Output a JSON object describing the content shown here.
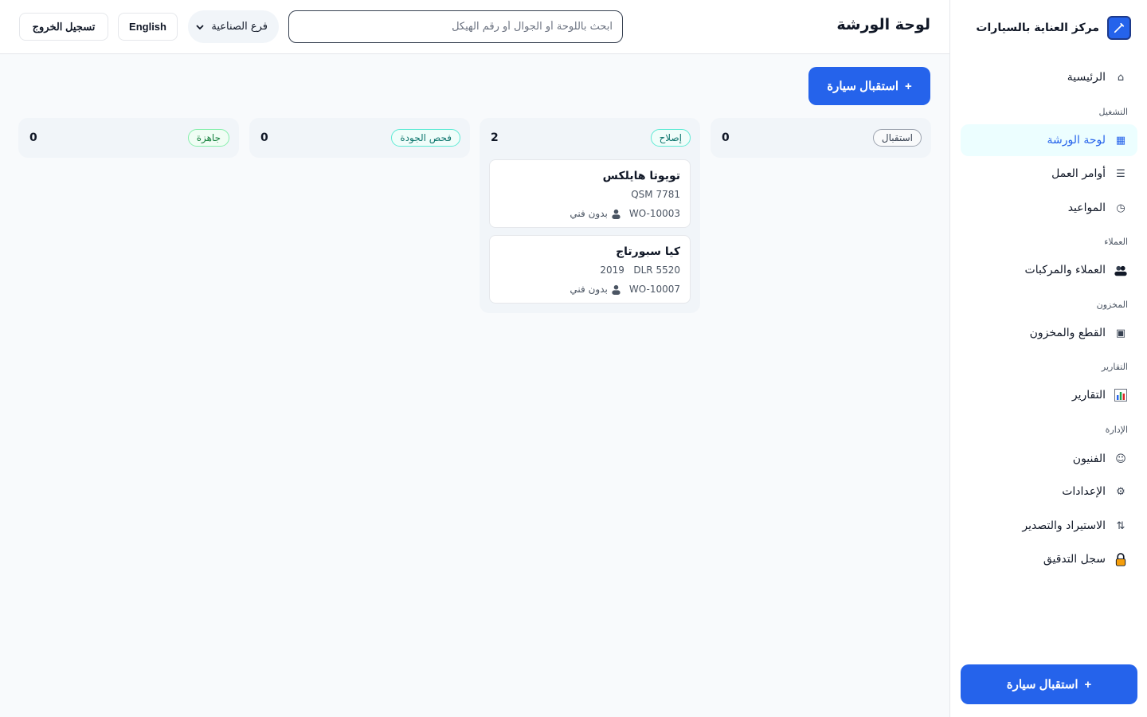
{
  "sidebar": {
    "brand_name": "مركز العناية بالسيارات",
    "home": "الرئيسية",
    "sections": {
      "operations": "التشغيل",
      "customers": "العملاء",
      "inventory": "المخزون",
      "reports": "التقارير",
      "admin": "الإدارة"
    },
    "items": {
      "workshop_board": "لوحة الورشة",
      "work_orders": "أوامر العمل",
      "appointments": "المواعيد",
      "customers_vehicles": "العملاء والمركبات",
      "parts_inventory": "القطع والمخزون",
      "reports": "التقارير",
      "technicians": "الفنيون",
      "settings": "الإعدادات",
      "import_export": "الاستيراد والتصدير",
      "audit_log": "سجل التدقيق"
    },
    "cta": "استقبال سيارة"
  },
  "header": {
    "title": "لوحة الورشة",
    "search_placeholder": "ابحث باللوحة أو الجوال أو رقم الهيكل",
    "branch": "فرع الصناعية",
    "language": "English",
    "logout": "تسجيل الخروج"
  },
  "main": {
    "cta": "استقبال سيارة",
    "columns": [
      {
        "label": "استقبال",
        "count": "0",
        "cards": []
      },
      {
        "label": "إصلاح",
        "count": "2",
        "cards": [
          {
            "title": "تويوتا هايلكس",
            "plate": "QSM 7781",
            "year": "",
            "order": "WO-10003",
            "tech": "بدون فني"
          },
          {
            "title": "كيا سبورتاج",
            "plate": "DLR 5520",
            "year": "2019",
            "order": "WO-10007",
            "tech": "بدون فني"
          }
        ]
      },
      {
        "label": "فحص الجودة",
        "count": "0",
        "cards": []
      },
      {
        "label": "جاهزة",
        "count": "0",
        "cards": []
      }
    ]
  },
  "colors": {
    "accent": "#2563eb",
    "active_bg": "#ecfeff",
    "badge_teal": "#0f766e",
    "badge_green": "#15803d"
  }
}
